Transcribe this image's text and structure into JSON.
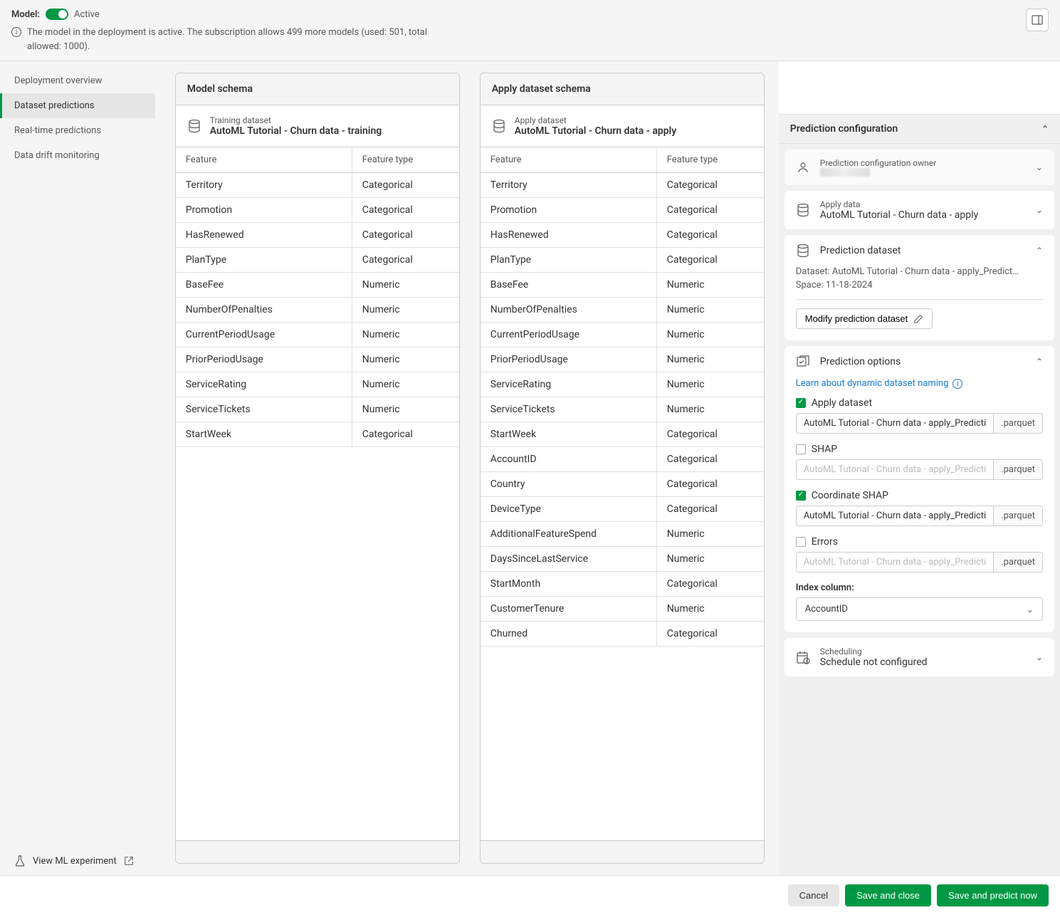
{
  "top": {
    "model_label": "Model:",
    "status": "Active",
    "info": "The model in the deployment is active. The subscription allows 499 more models (used: 501, total allowed: 1000)."
  },
  "sidebar": {
    "items": [
      {
        "label": "Deployment overview",
        "active": false
      },
      {
        "label": "Dataset predictions",
        "active": true
      },
      {
        "label": "Real-time predictions",
        "active": false
      },
      {
        "label": "Data drift monitoring",
        "active": false
      }
    ],
    "view_experiment": "View ML experiment"
  },
  "model_schema": {
    "title": "Model schema",
    "dataset_label": "Training dataset",
    "dataset_name": "AutoML Tutorial - Churn data - training",
    "headers": {
      "feature": "Feature",
      "type": "Feature type"
    },
    "rows": [
      {
        "f": "Territory",
        "t": "Categorical"
      },
      {
        "f": "Promotion",
        "t": "Categorical"
      },
      {
        "f": "HasRenewed",
        "t": "Categorical"
      },
      {
        "f": "PlanType",
        "t": "Categorical"
      },
      {
        "f": "BaseFee",
        "t": "Numeric"
      },
      {
        "f": "NumberOfPenalties",
        "t": "Numeric"
      },
      {
        "f": "CurrentPeriodUsage",
        "t": "Numeric"
      },
      {
        "f": "PriorPeriodUsage",
        "t": "Numeric"
      },
      {
        "f": "ServiceRating",
        "t": "Numeric"
      },
      {
        "f": "ServiceTickets",
        "t": "Numeric"
      },
      {
        "f": "StartWeek",
        "t": "Categorical"
      }
    ]
  },
  "apply_schema": {
    "title": "Apply dataset schema",
    "dataset_label": "Apply dataset",
    "dataset_name": "AutoML Tutorial - Churn data - apply",
    "headers": {
      "feature": "Feature",
      "type": "Feature type"
    },
    "rows": [
      {
        "f": "Territory",
        "t": "Categorical"
      },
      {
        "f": "Promotion",
        "t": "Categorical"
      },
      {
        "f": "HasRenewed",
        "t": "Categorical"
      },
      {
        "f": "PlanType",
        "t": "Categorical"
      },
      {
        "f": "BaseFee",
        "t": "Numeric"
      },
      {
        "f": "NumberOfPenalties",
        "t": "Numeric"
      },
      {
        "f": "CurrentPeriodUsage",
        "t": "Numeric"
      },
      {
        "f": "PriorPeriodUsage",
        "t": "Numeric"
      },
      {
        "f": "ServiceRating",
        "t": "Numeric"
      },
      {
        "f": "ServiceTickets",
        "t": "Numeric"
      },
      {
        "f": "StartWeek",
        "t": "Categorical"
      },
      {
        "f": "AccountID",
        "t": "Categorical"
      },
      {
        "f": "Country",
        "t": "Categorical"
      },
      {
        "f": "DeviceType",
        "t": "Categorical"
      },
      {
        "f": "AdditionalFeatureSpend",
        "t": "Numeric"
      },
      {
        "f": "DaysSinceLastService",
        "t": "Numeric"
      },
      {
        "f": "StartMonth",
        "t": "Categorical"
      },
      {
        "f": "CustomerTenure",
        "t": "Numeric"
      },
      {
        "f": "Churned",
        "t": "Categorical"
      }
    ]
  },
  "prediction": {
    "panel_title": "Prediction configuration",
    "owner_label": "Prediction configuration owner",
    "apply_data_label": "Apply data",
    "apply_data_value": "AutoML Tutorial - Churn data - apply",
    "dataset_title": "Prediction dataset",
    "dataset_line": "Dataset: AutoML Tutorial - Churn data - apply_Predict…",
    "space_line": "Space: 11-18-2024",
    "modify_btn": "Modify prediction dataset",
    "options_title": "Prediction options",
    "learn_link": "Learn about dynamic dataset naming",
    "opts": [
      {
        "label": "Apply dataset",
        "checked": true,
        "file": "AutoML Tutorial - Churn data - apply_Predicti",
        "ext": ".parquet"
      },
      {
        "label": "SHAP",
        "checked": false,
        "file": "AutoML Tutorial - Churn data - apply_Predicti",
        "ext": ".parquet"
      },
      {
        "label": "Coordinate SHAP",
        "checked": true,
        "file": "AutoML Tutorial - Churn data - apply_Predicti",
        "ext": ".parquet"
      },
      {
        "label": "Errors",
        "checked": false,
        "file": "AutoML Tutorial - Churn data - apply_Predicti",
        "ext": ".parquet"
      }
    ],
    "index_label": "Index column:",
    "index_value": "AccountID",
    "scheduling_label": "Scheduling",
    "scheduling_value": "Schedule not configured"
  },
  "footer": {
    "cancel": "Cancel",
    "save_close": "Save and close",
    "save_predict": "Save and predict now"
  }
}
